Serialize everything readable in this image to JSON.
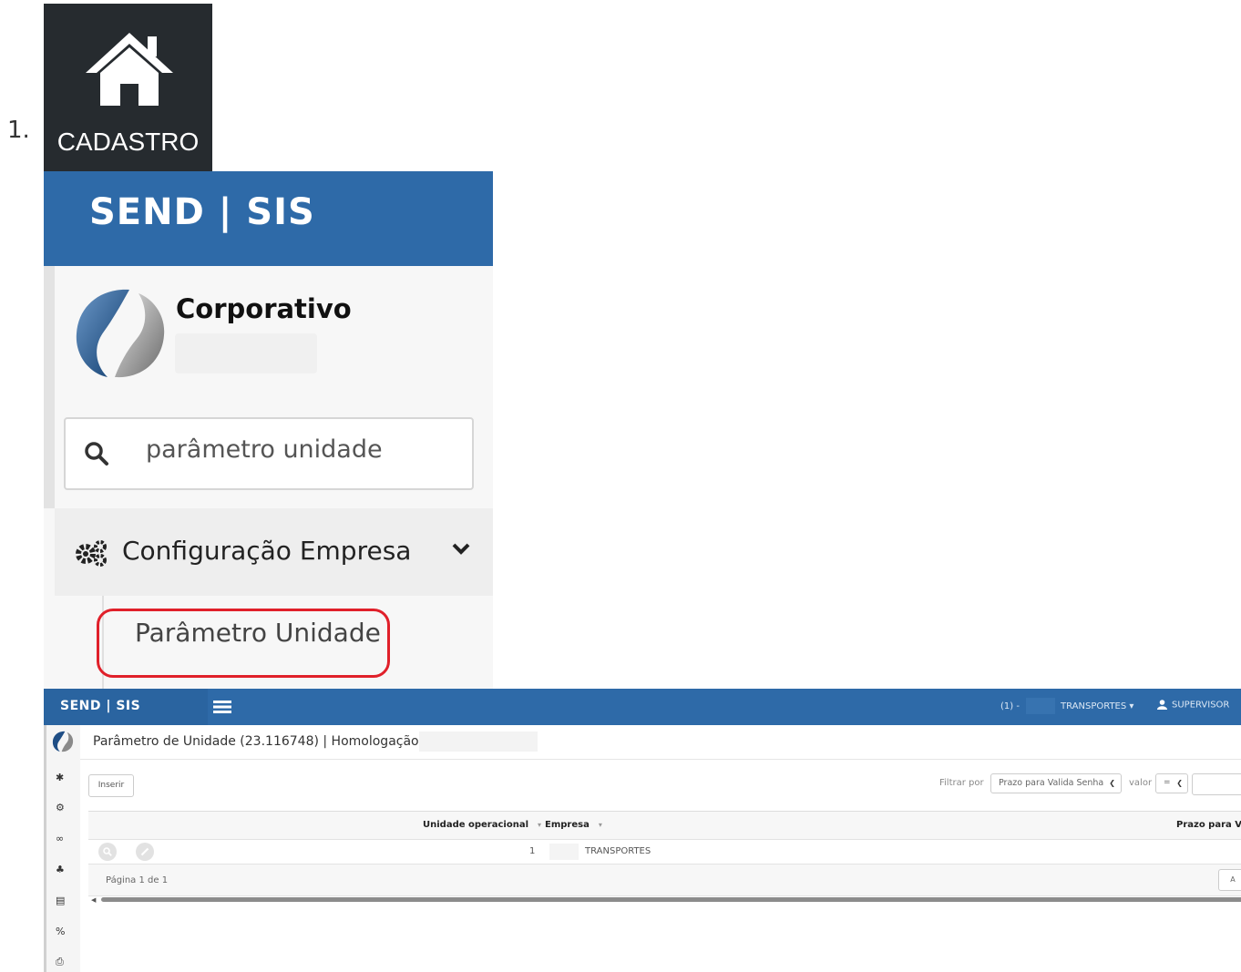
{
  "step": {
    "number": "1."
  },
  "cadastro_tile": {
    "label": "CADASTRO",
    "icon": "home-icon",
    "bg": "#262b2f"
  },
  "zoom": {
    "brand": "SEND | SIS",
    "header_color": "#2e6aa8",
    "profile_name": "Corporativo",
    "search_value": "parâmetro unidade",
    "menu_label": "Configuração Empresa",
    "menu_icon": "gears-icon",
    "submenu_label": "Parâmetro Unidade",
    "highlight_color": "#e0202a"
  },
  "app": {
    "brand": "SEND | SIS",
    "nav": {
      "counter": "(1) -",
      "company": "TRANSPORTES",
      "user": "SUPERVISOR"
    },
    "title": "Parâmetro de Unidade (23.116748) | Homologação |",
    "insert_label": "Inserir",
    "filter_label": "Filtrar por",
    "filter_value": "Prazo para Valida Senha",
    "valor_label": "valor",
    "operator_value": "=",
    "columns": {
      "unidade": "Unidade operacional",
      "empresa": "Empresa",
      "prazo": "Prazo para V"
    },
    "rows": [
      {
        "unidade": "1",
        "empresa": "TRANSPORTES"
      }
    ],
    "pager": "Página 1 de 1",
    "foot_button": "A",
    "sidebar_icons": [
      "home-icon",
      "gears-icon",
      "handshake-icon",
      "sitemap-icon",
      "bank-icon",
      "percent-icon",
      "print-icon"
    ]
  }
}
